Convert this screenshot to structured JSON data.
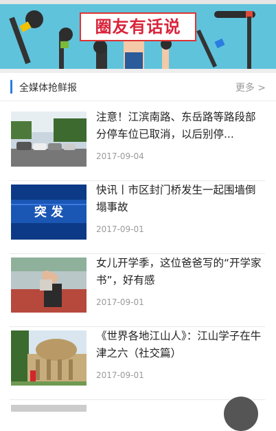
{
  "banner": {
    "title": "圈友有话说"
  },
  "section": {
    "title": "全媒体抢鲜报",
    "more": "更多 >"
  },
  "articles": [
    {
      "headline": "注意！江滨南路、东岳路等路段部分停车位已取消，以后别停...",
      "date": "2017-09-04",
      "thumb_icon": "street-parking-photo"
    },
    {
      "headline": "快讯丨市区封门桥发生一起围墙倒塌事故",
      "date": "2017-09-01",
      "thumb_icon": "breaking-news-graphic",
      "thumb_text": "突 发"
    },
    {
      "headline": "女儿开学季，这位爸爸写的“开学家书”，好有感",
      "date": "2017-09-01",
      "thumb_icon": "father-daughter-photo"
    },
    {
      "headline": "《世界各地江山人》：江山学子在牛津之六（社交篇）",
      "date": "2017-09-01",
      "thumb_icon": "oxford-building-photo"
    }
  ],
  "partial_article": {
    "headline": ""
  }
}
